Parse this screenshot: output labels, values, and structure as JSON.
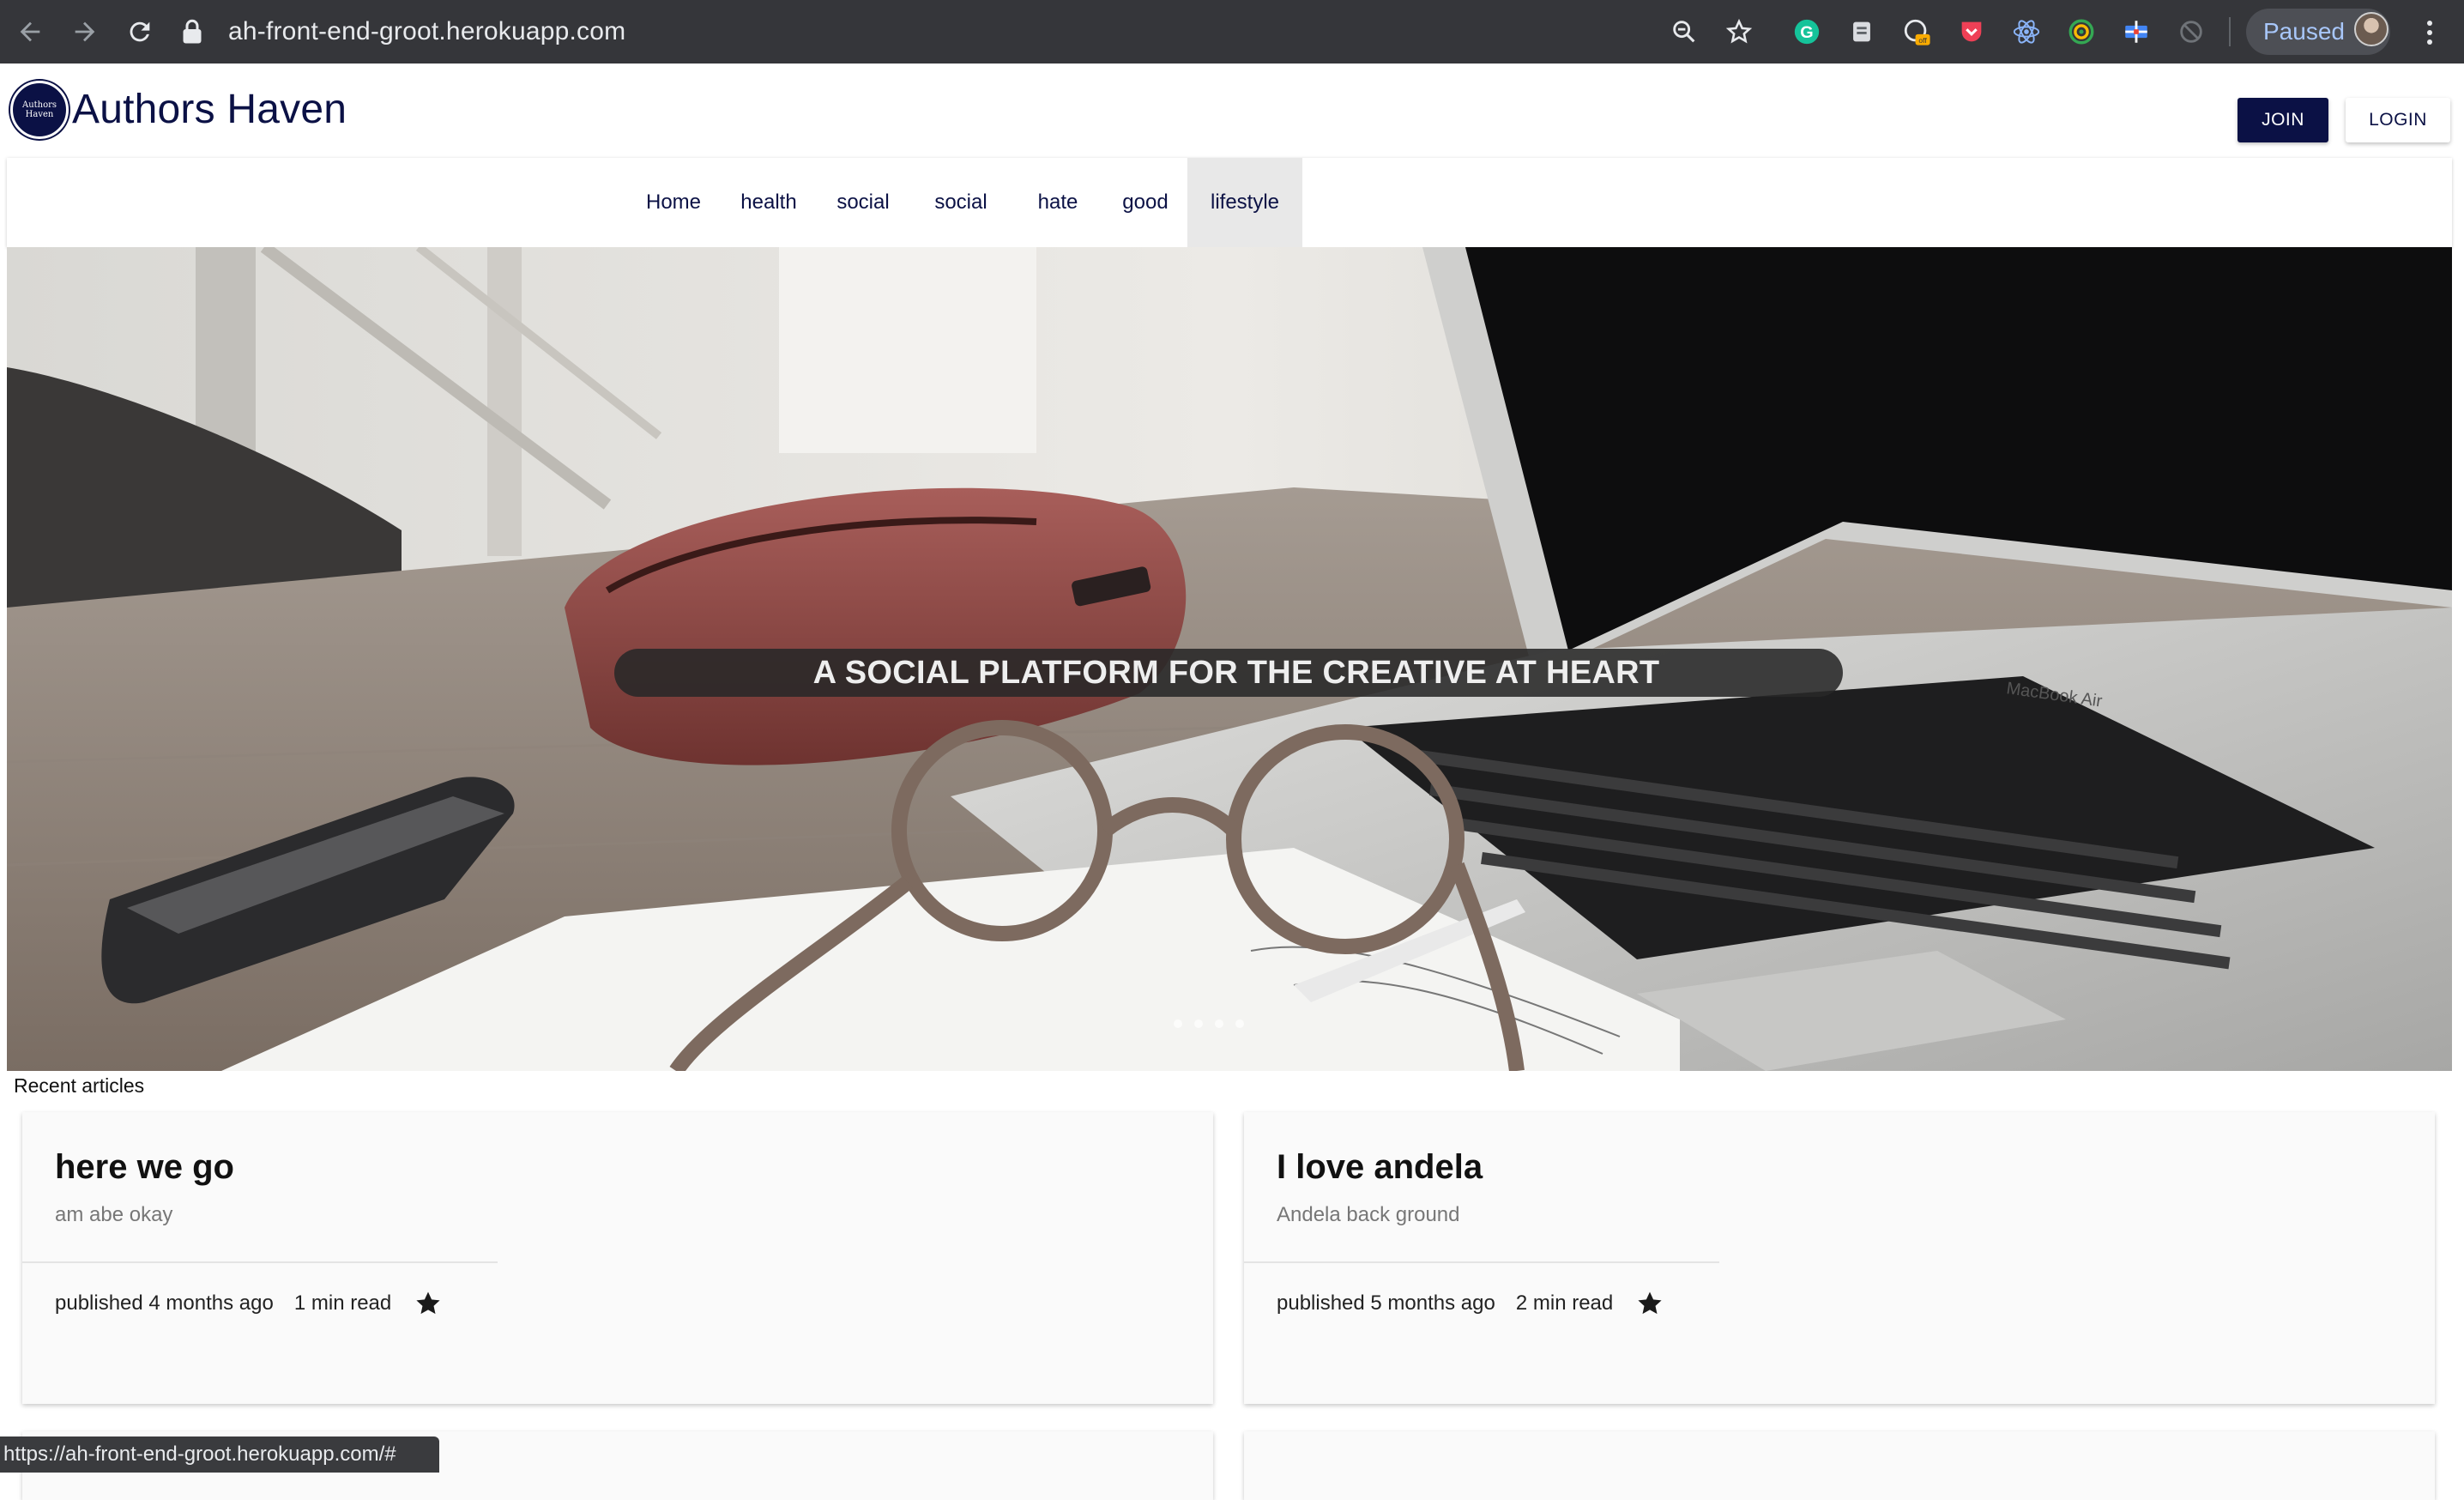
{
  "browser": {
    "url": "ah-front-end-groot.herokuapp.com",
    "profile_status": "Paused",
    "status_url": "https://ah-front-end-groot.herokuapp.com/#",
    "extensions": [
      "grammarly-icon",
      "extension-icon",
      "extension-off-icon",
      "pocket-icon",
      "react-devtools-icon",
      "target-icon",
      "extension-icon",
      "sync-icon"
    ],
    "extension_badge": "off"
  },
  "header": {
    "logo_text": [
      "Authors",
      "Haven"
    ],
    "brand": "Authors Haven",
    "join_label": "JOIN",
    "login_label": "LOGIN",
    "brand_color": "#0b1145"
  },
  "nav": {
    "items": [
      "Home",
      "health",
      "social",
      "social",
      "hate",
      "good",
      "lifestyle"
    ],
    "active": "lifestyle"
  },
  "hero": {
    "tagline": "A SOCIAL PLATFORM FOR THE CREATIVE AT HEART",
    "laptop_label": "MacBook Air"
  },
  "recent": {
    "label": "Recent articles",
    "articles": [
      {
        "title": "here we go",
        "description": "am abe okay",
        "published": "published 4 months ago",
        "read_time": "1 min read"
      },
      {
        "title": "I love andela",
        "description": "Andela back ground",
        "published": "published 5 months ago",
        "read_time": "2 min read"
      }
    ]
  }
}
